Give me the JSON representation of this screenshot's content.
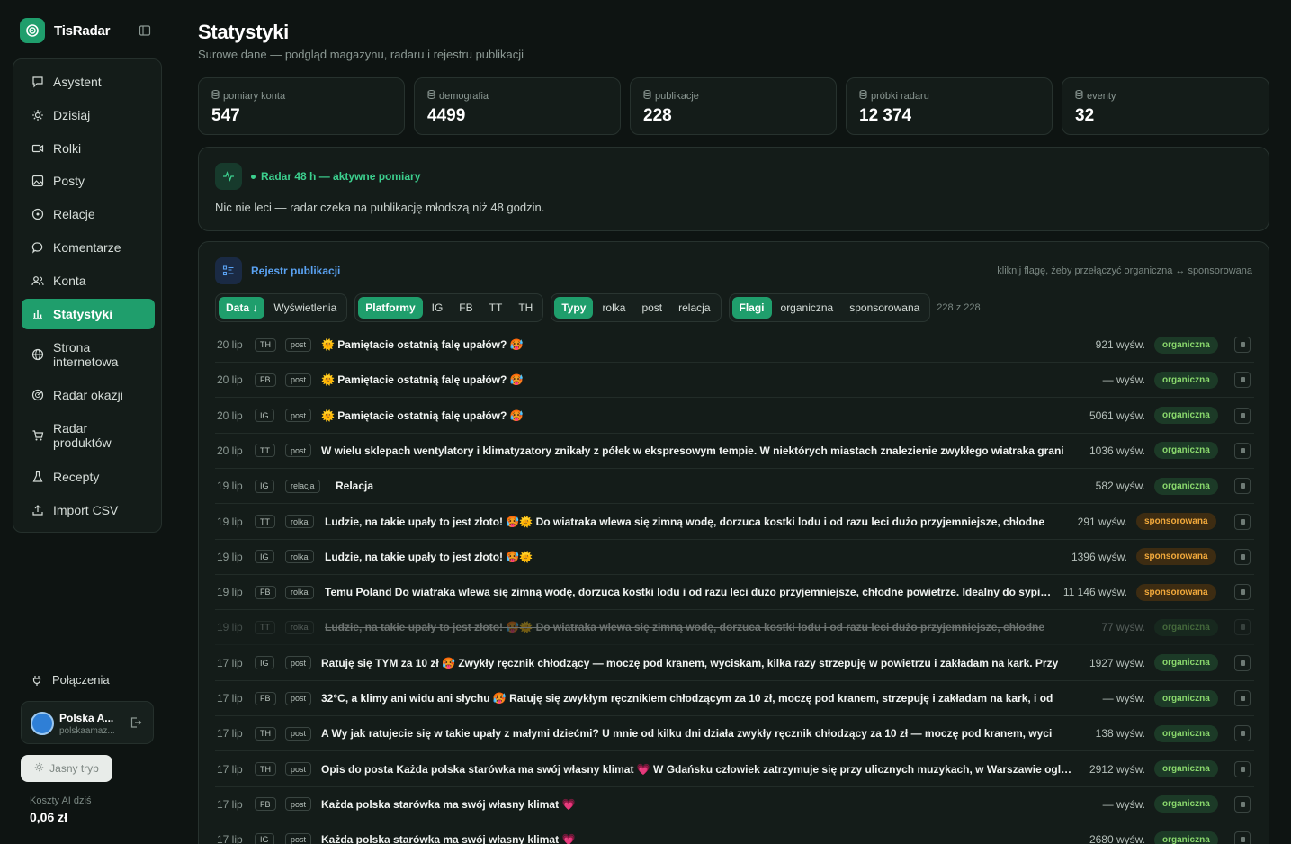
{
  "app": {
    "name": "TisRadar"
  },
  "sidebar": {
    "items": [
      {
        "label": "Asystent",
        "icon": "chat-icon"
      },
      {
        "label": "Dzisiaj",
        "icon": "sun-icon"
      },
      {
        "label": "Rolki",
        "icon": "video-icon"
      },
      {
        "label": "Posty",
        "icon": "image-icon"
      },
      {
        "label": "Relacje",
        "icon": "circle-play-icon"
      },
      {
        "label": "Komentarze",
        "icon": "comment-icon"
      },
      {
        "label": "Konta",
        "icon": "users-icon"
      },
      {
        "label": "Statystyki",
        "icon": "bar-chart-icon",
        "active": true
      },
      {
        "label": "Strona internetowa",
        "icon": "globe-icon"
      },
      {
        "label": "Radar okazji",
        "icon": "radar-icon"
      },
      {
        "label": "Radar produktów",
        "icon": "cart-icon"
      },
      {
        "label": "Recepty",
        "icon": "flask-icon"
      },
      {
        "label": "Import CSV",
        "icon": "upload-icon"
      }
    ],
    "connections_label": "Połączenia",
    "account": {
      "name": "Polska A...",
      "email": "polskaamaz..."
    },
    "theme_label": "Jasny tryb",
    "cost_label": "Koszty AI dziś",
    "cost_value": "0,06 zł"
  },
  "header": {
    "title": "Statystyki",
    "subtitle": "Surowe dane — podgląd magazynu, radaru i rejestru publikacji"
  },
  "stats": [
    {
      "label": "pomiary konta",
      "value": "547"
    },
    {
      "label": "demografia",
      "value": "4499"
    },
    {
      "label": "publikacje",
      "value": "228"
    },
    {
      "label": "próbki radaru",
      "value": "12 374"
    },
    {
      "label": "eventy",
      "value": "32"
    }
  ],
  "radar": {
    "title": "Radar 48 h — aktywne pomiary",
    "message": "Nic nie leci — radar czeka na publikację młodszą niż 48 godzin."
  },
  "registry": {
    "title": "Rejestr publikacji",
    "hint": "kliknij flagę, żeby przełączyć organiczna ↔ sponsorowana",
    "sort": {
      "date": "Data ↓",
      "views": "Wyświetlenia"
    },
    "platforms": {
      "all": "Platformy",
      "ig": "IG",
      "fb": "FB",
      "tt": "TT",
      "th": "TH"
    },
    "types": {
      "all": "Typy",
      "reel": "rolka",
      "post": "post",
      "story": "relacja"
    },
    "flags": {
      "all": "Flagi",
      "organic": "organiczna",
      "sponsored": "sponsorowana"
    },
    "count": "228 z 228",
    "rows": [
      {
        "date": "20 lip",
        "platform": "TH",
        "type": "post",
        "text": "🌞 Pamiętacie ostatnią falę upałów? 🥵",
        "views": "921 wyśw.",
        "flag": "organiczna"
      },
      {
        "date": "20 lip",
        "platform": "FB",
        "type": "post",
        "text": "🌞 Pamiętacie ostatnią falę upałów? 🥵",
        "views": "— wyśw.",
        "flag": "organiczna"
      },
      {
        "date": "20 lip",
        "platform": "IG",
        "type": "post",
        "text": "🌞 Pamiętacie ostatnią falę upałów? 🥵",
        "views": "5061 wyśw.",
        "flag": "organiczna"
      },
      {
        "date": "20 lip",
        "platform": "TT",
        "type": "post",
        "text": "W wielu sklepach wentylatory i klimatyzatory znikały z półek w ekspresowym tempie. W niektórych miastach znalezienie zwykłego wiatraka grani",
        "views": "1036 wyśw.",
        "flag": "organiczna"
      },
      {
        "date": "19 lip",
        "platform": "IG",
        "type": "relacja",
        "text": "Relacja",
        "views": "582 wyśw.",
        "flag": "organiczna"
      },
      {
        "date": "19 lip",
        "platform": "TT",
        "type": "rolka",
        "text": "Ludzie, na takie upały to jest złoto! 🥵🌞 Do wiatraka wlewa się zimną wodę, dorzuca kostki lodu i od razu leci dużo przyjemniejsze, chłodne",
        "views": "291 wyśw.",
        "flag": "sponsorowana"
      },
      {
        "date": "19 lip",
        "platform": "IG",
        "type": "rolka",
        "text": "Ludzie, na takie upały to jest złoto! 🥵🌞",
        "views": "1396 wyśw.",
        "flag": "sponsorowana"
      },
      {
        "date": "19 lip",
        "platform": "FB",
        "type": "rolka",
        "text": "Temu Poland Do wiatraka wlewa się zimną wodę, dorzuca kostki lodu i od razu leci dużo przyjemniejsze, chłodne powietrze. Idealny do sypialni",
        "views": "11 146 wyśw.",
        "flag": "sponsorowana"
      },
      {
        "date": "19 lip",
        "platform": "TT",
        "type": "rolka",
        "text": "Ludzie, na takie upały to jest złoto! 🥵🌞 Do wiatraka wlewa się zimną wodę, dorzuca kostki lodu i od razu leci dużo przyjemniejsze, chłodne",
        "views": "77 wyśw.",
        "flag": "organiczna",
        "muted": true
      },
      {
        "date": "17 lip",
        "platform": "IG",
        "type": "post",
        "text": "Ratuję się TYM za 10 zł 🥵 Zwykły ręcznik chłodzący — moczę pod kranem, wyciskam, kilka razy strzepuję w powietrzu i zakładam na kark. Przy",
        "views": "1927 wyśw.",
        "flag": "organiczna"
      },
      {
        "date": "17 lip",
        "platform": "FB",
        "type": "post",
        "text": "32°C, a klimy ani widu ani słychu 🥵 Ratuję się zwykłym ręcznikiem chłodzącym za 10 zł, moczę pod kranem, strzepuję i zakładam na kark, i od",
        "views": "— wyśw.",
        "flag": "organiczna"
      },
      {
        "date": "17 lip",
        "platform": "TH",
        "type": "post",
        "text": "A Wy jak ratujecie się w takie upały z małymi dziećmi? U mnie od kilku dni działa zwykły ręcznik chłodzący za 10 zł — moczę pod kranem, wyci",
        "views": "138 wyśw.",
        "flag": "organiczna"
      },
      {
        "date": "17 lip",
        "platform": "TH",
        "type": "post",
        "text": "Opis do posta Każda polska starówka ma swój własny klimat 💗 W Gdańsku człowiek zatrzymuje się przy ulicznych muzykach, w Warszawie oglą…",
        "views": "2912 wyśw.",
        "flag": "organiczna"
      },
      {
        "date": "17 lip",
        "platform": "FB",
        "type": "post",
        "text": "Każda polska starówka ma swój własny klimat 💗",
        "views": "— wyśw.",
        "flag": "organiczna"
      },
      {
        "date": "17 lip",
        "platform": "IG",
        "type": "post",
        "text": "Każda polska starówka ma swój własny klimat 💗",
        "views": "2680 wyśw.",
        "flag": "organiczna"
      }
    ]
  }
}
